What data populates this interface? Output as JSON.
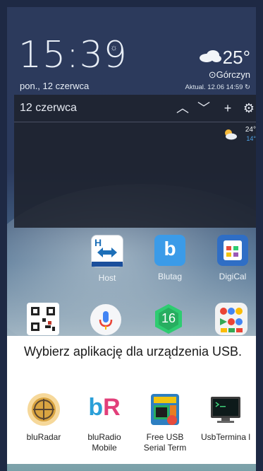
{
  "lockscreen": {
    "time": "15:39",
    "date": "pon., 12 czerwca",
    "weather": {
      "temp": "25°",
      "city": "Górczyn",
      "updated": "Aktual. 12.06 14:59"
    }
  },
  "calendar_widget": {
    "title": "12 czerwca",
    "weather_high": "24°",
    "weather_low": "14°"
  },
  "home_apps": [
    {
      "label": "Host"
    },
    {
      "label": "Blutag"
    },
    {
      "label": "DigiCal"
    }
  ],
  "dock_badge": "16",
  "dialog": {
    "title": "Wybierz aplikację dla urządzenia USB.",
    "options": [
      {
        "label": "bluRadar"
      },
      {
        "label": "bluRadio Mobile"
      },
      {
        "label": "Free USB Serial Term"
      },
      {
        "label": "UsbTermina l"
      }
    ]
  },
  "colors": {
    "dialog_bg": "#ffffff",
    "accent_blue": "#2f8fd8"
  }
}
